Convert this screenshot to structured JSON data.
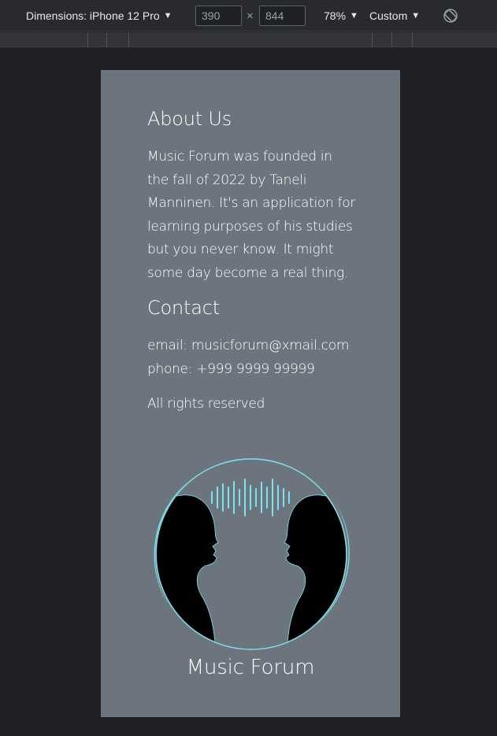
{
  "devtools": {
    "device_label": "Dimensions: iPhone 12 Pro",
    "width_value": "390",
    "height_value": "844",
    "times_symbol": "×",
    "zoom_label": "78%",
    "throttle_label": "Custom",
    "caret_icon": "▼",
    "rotate_icon": "rotate-icon"
  },
  "page": {
    "about_heading": "About Us",
    "about_lines": [
      "Music Forum was founded in",
      "the fall of 2022 by Taneli",
      "Manninen. It's an application for",
      "learning purposes of his studies",
      "but you never know. It might",
      "some day become a real thing."
    ],
    "contact_heading": "Contact",
    "email_line": "email: musicforum@xmail.com",
    "phone_line": "phone: +999 9999 99999",
    "rights": "All rights reserved",
    "brand_name": "Music Forum"
  },
  "colors": {
    "page_background": "#6c757d",
    "logo_accent": "#7fe3ef",
    "devtools_background": "#202124"
  }
}
